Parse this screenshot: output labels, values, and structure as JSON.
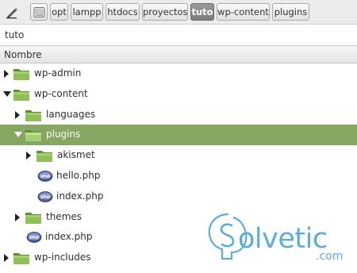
{
  "toolbar": {
    "crumbs": [
      {
        "label": "opt"
      },
      {
        "label": "lampp"
      },
      {
        "label": "htdocs"
      },
      {
        "label": "proyectos"
      },
      {
        "label": "tuto"
      },
      {
        "label": "wp-content"
      },
      {
        "label": "plugins"
      }
    ],
    "active_crumb": "tuto"
  },
  "location": {
    "value": "tuto"
  },
  "columns": {
    "name": "Nombre"
  },
  "tree": [
    {
      "name": "wp-admin",
      "type": "folder",
      "expanded": false
    },
    {
      "name": "wp-content",
      "type": "folder",
      "expanded": true
    },
    {
      "name": "languages",
      "type": "folder",
      "expanded": false
    },
    {
      "name": "plugins",
      "type": "folder",
      "expanded": true,
      "selected": true
    },
    {
      "name": "akismet",
      "type": "folder",
      "expanded": false
    },
    {
      "name": "hello.php",
      "type": "php-file"
    },
    {
      "name": "index.php",
      "type": "php-file"
    },
    {
      "name": "themes",
      "type": "folder",
      "expanded": false
    },
    {
      "name": "index.php",
      "type": "php-file"
    },
    {
      "name": "wp-includes",
      "type": "folder",
      "expanded": false
    }
  ],
  "watermark": {
    "brand": "olvetic",
    "domain": ".com"
  },
  "colors": {
    "selection": "#86a761",
    "folder": "#7fae4a",
    "watermark": "#5aaed9"
  }
}
